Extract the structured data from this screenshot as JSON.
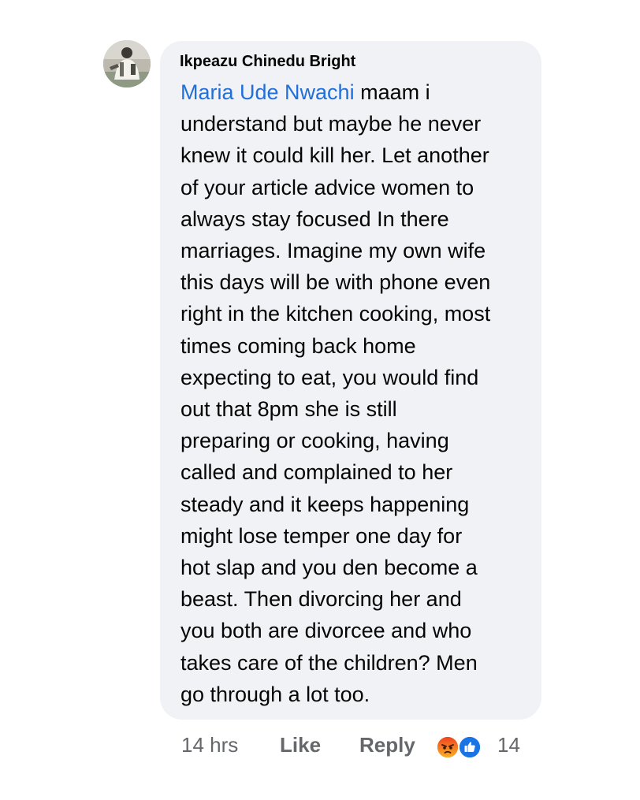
{
  "comment": {
    "author": "Ikpeazu Chinedu Bright",
    "mention": "Maria Ude Nwachi",
    "lines": [
      " maam i",
      "understand but maybe he never",
      "knew it could kill her. Let another",
      "of your article advice women to",
      "always stay focused In there",
      "marriages. Imagine my own wife",
      "this days will be with phone even",
      "right in the kitchen cooking, most",
      "times coming back home",
      "expecting to eat, you would find",
      "out that 8pm she is still",
      "preparing or cooking, having",
      "called and complained to her",
      "steady and it keeps happening",
      "might lose temper one day for",
      "hot slap and you den become a",
      "beast. Then divorcing her and",
      "you both are divorcee and who",
      "takes care of the children? Men",
      "go through a lot too."
    ]
  },
  "meta": {
    "time": "14 hrs",
    "like_label": "Like",
    "reply_label": "Reply",
    "reactions": [
      "angry-icon",
      "like-icon"
    ],
    "reaction_count": "14"
  },
  "colors": {
    "bubble": "#f0f2f5",
    "mention": "#216fdb",
    "text": "#050505",
    "meta": "#65676b"
  }
}
